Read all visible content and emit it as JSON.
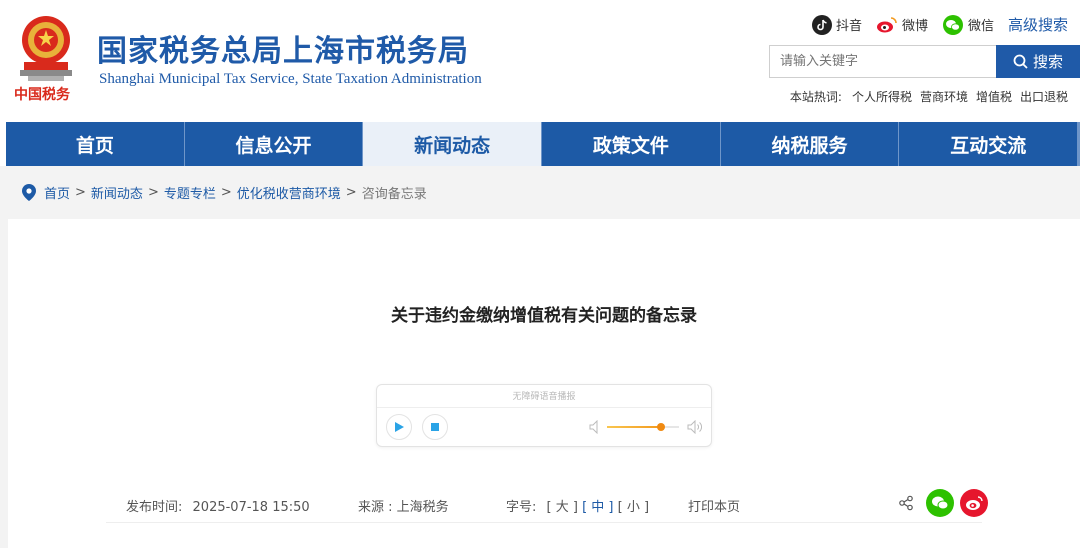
{
  "header": {
    "title": "国家税务总局上海市税务局",
    "subtitle": "Shanghai Municipal Tax Service, State Taxation Administration",
    "emblem_caption": "中国税务",
    "social": [
      {
        "label": "抖音",
        "icon": "douyin-icon"
      },
      {
        "label": "微博",
        "icon": "weibo-icon"
      },
      {
        "label": "微信",
        "icon": "wechat-icon"
      }
    ],
    "advanced_search": "高级搜索",
    "search": {
      "placeholder": "请输入关键字",
      "button": "搜索"
    },
    "hot": {
      "label": "本站热词:",
      "items": [
        "个人所得税",
        "营商环境",
        "增值税",
        "出口退税"
      ]
    }
  },
  "nav": {
    "items": [
      "首页",
      "信息公开",
      "新闻动态",
      "政策文件",
      "纳税服务",
      "互动交流"
    ],
    "active_index": 2
  },
  "breadcrumb": {
    "items": [
      "首页",
      "新闻动态",
      "专题专栏",
      "优化税收营商环境"
    ],
    "current": "咨询备忘录",
    "separator": ">"
  },
  "article": {
    "title": "关于违约金缴纳增值税有关问题的备忘录",
    "player": {
      "label": "无障碍语音播报",
      "volume_fraction": 0.75
    },
    "meta": {
      "publish_label": "发布时间:",
      "publish_time": "2025-07-18 15:50",
      "source_label": "来源 :",
      "source": "上海税务",
      "font_size_label": "字号:",
      "font_sizes": [
        "[ 大 ]",
        "[ 中 ]",
        "[ 小 ]"
      ],
      "font_size_selected": 1,
      "print": "打印本页"
    }
  },
  "colors": {
    "brand": "#1d5aa6",
    "wechat": "#2dc100",
    "weibo": "#e6162d",
    "volume": "#f08a12"
  }
}
